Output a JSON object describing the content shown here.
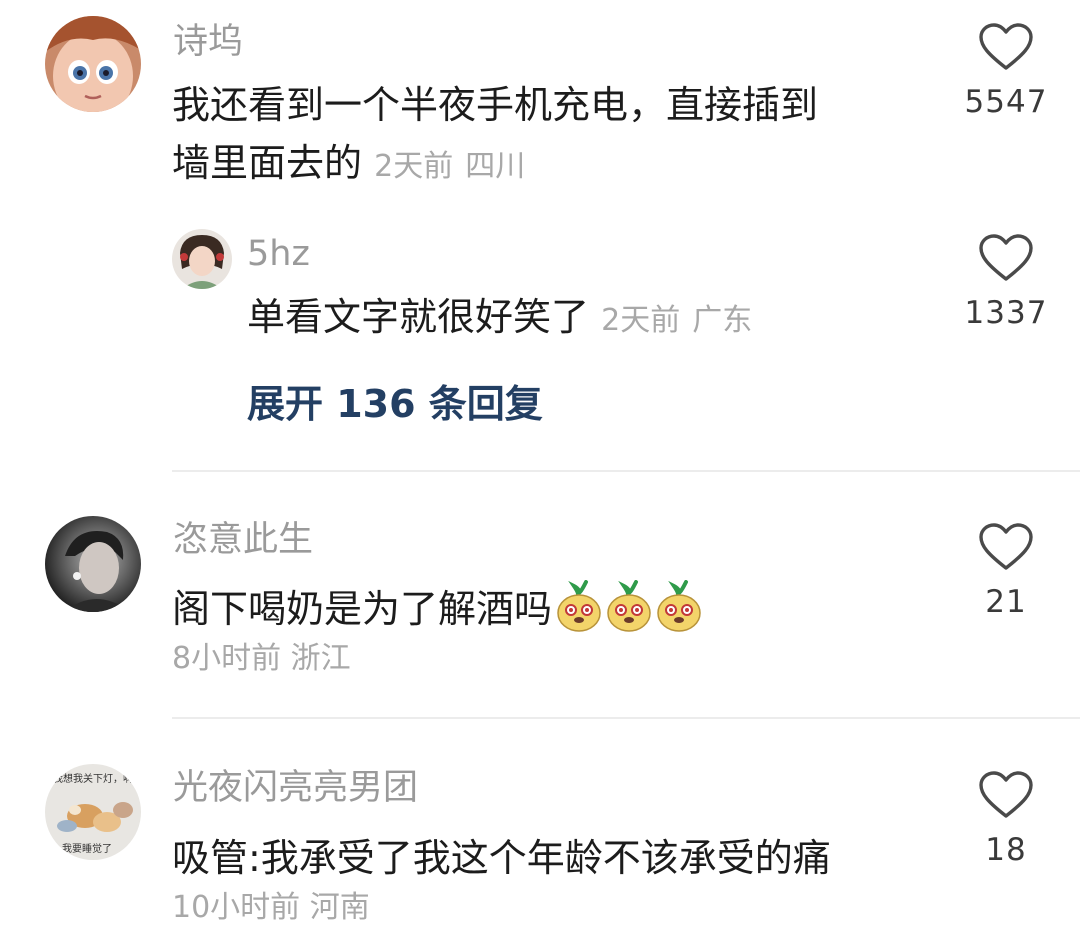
{
  "comments": [
    {
      "username": "诗坞",
      "text_line1": "我还看到一个半夜手机充电，直接插到",
      "text_line2": "墙里面去的",
      "time": "2天前",
      "location": "四川",
      "likes": "5547",
      "reply": {
        "username": "5hz",
        "text": "单看文字就很好笑了",
        "time": "2天前",
        "location": "广东",
        "likes": "1337"
      },
      "expand_label": "展开 136 条回复"
    },
    {
      "username": "恣意此生",
      "text": "阁下喝奶是为了解酒吗",
      "emoji": "pear-face-emoji",
      "time": "8小时前",
      "location": "浙江",
      "likes": "21"
    },
    {
      "username": "光夜闪亮亮男团",
      "text": "吸管:我承受了我这个年龄不该承受的痛",
      "time": "10小时前",
      "location": "河南",
      "likes": "18",
      "avatar_text_top": "我想我关下灯，啊",
      "avatar_text_bottom": "我要睡觉了"
    }
  ],
  "colors": {
    "username": "#9a9a9a",
    "content": "#1c1c1c",
    "meta": "#a8a8a8",
    "expand": "#233f63",
    "divider": "#ececec"
  },
  "icons": {
    "like": "heart-outline-icon"
  }
}
